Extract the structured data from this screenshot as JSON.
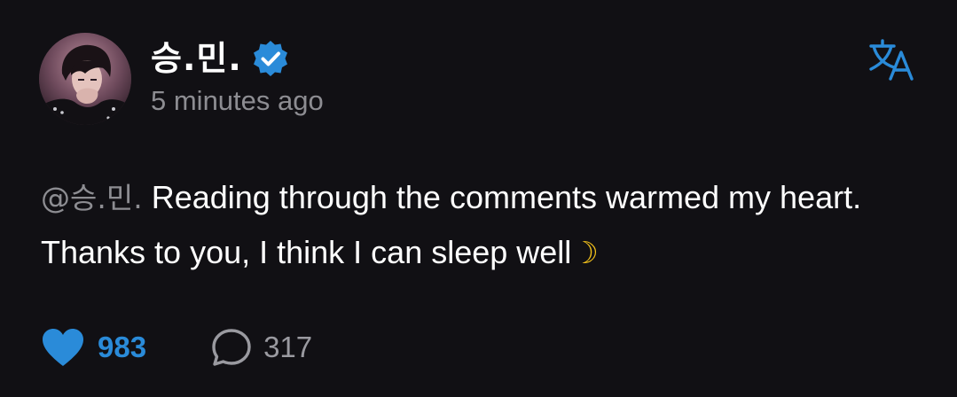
{
  "post": {
    "author": {
      "name": "승.민.",
      "verified": true,
      "avatar": "avatar"
    },
    "timestamp": "5 minutes ago",
    "translate_icon": "translate-icon",
    "body": {
      "mention": "@승.민.",
      "text": " Reading through the comments warmed my heart. Thanks to you, I think I can sleep well",
      "emoji": "☽"
    },
    "actions": {
      "likes": "983",
      "replies": "317",
      "like_icon": "heart-icon",
      "reply_icon": "speech-bubble-icon"
    },
    "colors": {
      "background": "#111014",
      "accent": "#2a8bd9",
      "muted_text": "#8d8d92",
      "moon": "#f4c21b"
    }
  }
}
